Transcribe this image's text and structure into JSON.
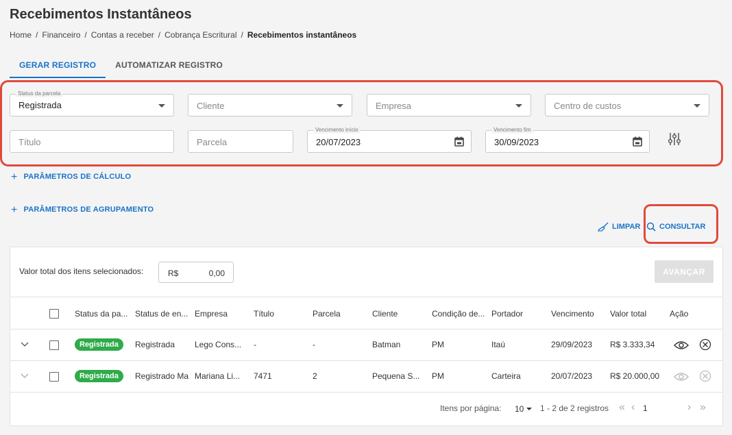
{
  "page": {
    "title": "Recebimentos Instantâneos"
  },
  "breadcrumb": {
    "items": [
      "Home",
      "Financeiro",
      "Contas a receber",
      "Cobrança Escritural"
    ],
    "current": "Recebimentos instantâneos",
    "separator": "/"
  },
  "tabs": [
    {
      "label": "GERAR REGISTRO",
      "active": true
    },
    {
      "label": "AUTOMATIZAR REGISTRO",
      "active": false
    }
  ],
  "filters": {
    "status_parcela": {
      "legend": "Status da parcela",
      "value": "Registrada"
    },
    "cliente": {
      "placeholder": "Cliente"
    },
    "empresa": {
      "placeholder": "Empresa"
    },
    "centro_custos": {
      "placeholder": "Centro de custos"
    },
    "titulo": {
      "placeholder": "Título"
    },
    "parcela": {
      "placeholder": "Parcela"
    },
    "vencimento_inicio": {
      "legend": "Vencimento início",
      "value": "20/07/2023"
    },
    "vencimento_fim": {
      "legend": "Vencimento fim",
      "value": "30/09/2023"
    }
  },
  "links": {
    "parametros_calculo": "PARÂMETROS DE CÁLCULO",
    "parametros_agrupamento": "PARÂMETROS DE AGRUPAMENTO",
    "plus": "+"
  },
  "actions": {
    "limpar": "LIMPAR",
    "consultar": "CONSULTAR"
  },
  "summary": {
    "label": "Valor total dos itens selecionados:",
    "currency": "R$",
    "amount": "0,00",
    "advance_label": "AVANÇAR"
  },
  "table": {
    "headers": [
      "Status da pa...",
      "Status de en...",
      "Empresa",
      "Título",
      "Parcela",
      "Cliente",
      "Condição de...",
      "Portador",
      "Vencimento",
      "Valor total",
      "Ação"
    ],
    "rows": [
      {
        "status_parcela": "Registrada",
        "status_envio": "Registrada",
        "empresa": "Lego Cons...",
        "titulo": "-",
        "parcela": "-",
        "cliente": "Batman",
        "condicao": "PM",
        "portador": "Itaú",
        "vencimento": "29/09/2023",
        "valor_total": "R$ 3.333,34"
      },
      {
        "status_parcela": "Registrada",
        "status_envio": "Registrado Ma",
        "empresa": "Mariana Li...",
        "titulo": "7471",
        "parcela": "2",
        "cliente": "Pequena S...",
        "condicao": "PM",
        "portador": "Carteira",
        "vencimento": "20/07/2023",
        "valor_total": "R$ 20.000,00"
      }
    ]
  },
  "pagination": {
    "items_per_page_label": "Itens por página:",
    "items_per_page": "10",
    "range": "1 - 2 de 2 registros",
    "current_page": "1",
    "first": "«",
    "prev": "‹",
    "next": "›",
    "last": "»"
  },
  "colors": {
    "accent": "#1a73c7",
    "badge_green": "#2eab4a",
    "highlight_red": "#e04a3a"
  }
}
